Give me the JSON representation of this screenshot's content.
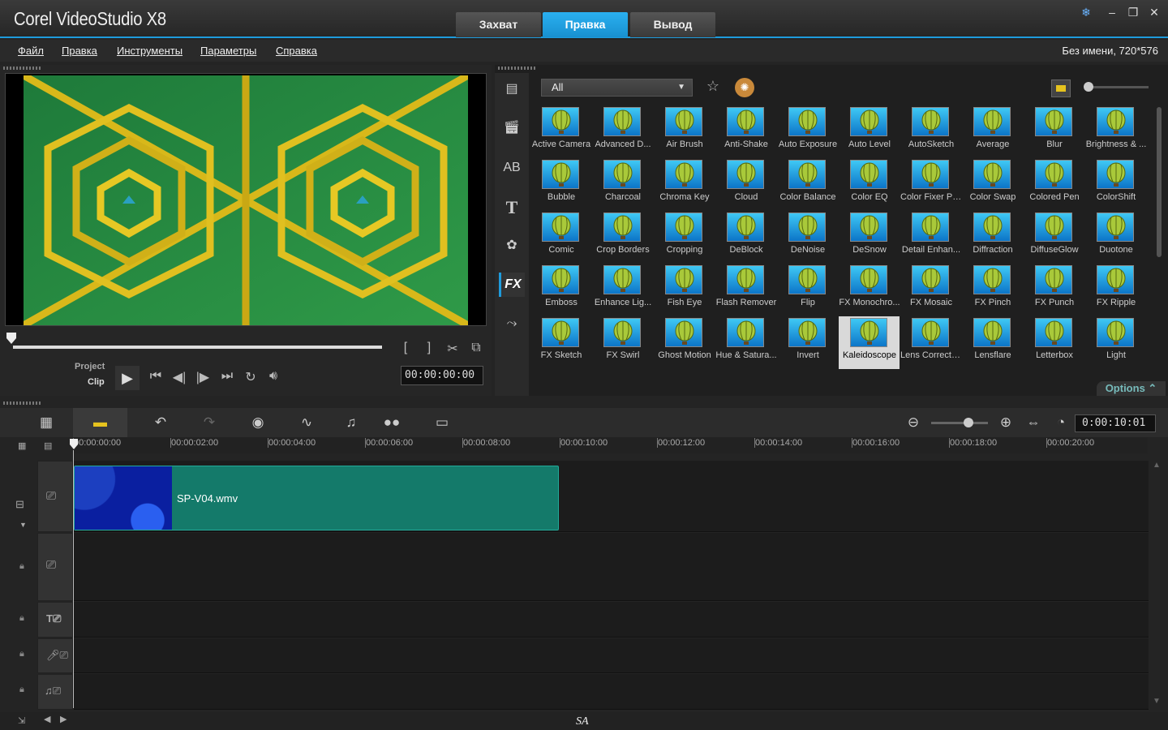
{
  "app": {
    "title": "Corel VideoStudio X8"
  },
  "mode_tabs": [
    {
      "label": "Захват"
    },
    {
      "label": "Правка"
    },
    {
      "label": "Вывод"
    }
  ],
  "window_buttons": {
    "minimize": "–",
    "restore": "❐",
    "close": "✕"
  },
  "menu": [
    "Файл",
    "Правка",
    "Инструменты",
    "Параметры",
    "Справка"
  ],
  "project_info": "Без имени, 720*576",
  "player": {
    "project_label": "Project",
    "clip_label": "Clip",
    "timecode": "00:00:00:00"
  },
  "library": {
    "filter_selected": "All",
    "options_label": "Options",
    "filters": [
      "Active Camera",
      "Advanced D...",
      "Air Brush",
      "Anti-Shake",
      "Auto Exposure",
      "Auto Level",
      "AutoSketch",
      "Average",
      "Blur",
      "Brightness & ...",
      "Bubble",
      "Charcoal",
      "Chroma Key",
      "Cloud",
      "Color Balance",
      "Color EQ",
      "Color Fixer Plus",
      "Color Swap",
      "Colored Pen",
      "ColorShift",
      "Comic",
      "Crop Borders",
      "Cropping",
      "DeBlock",
      "DeNoise",
      "DeSnow",
      "Detail Enhan...",
      "Diffraction",
      "DiffuseGlow",
      "Duotone",
      "Emboss",
      "Enhance Lig...",
      "Fish Eye",
      "Flash Remover",
      "Flip",
      "FX Monochro...",
      "FX Mosaic",
      "FX Pinch",
      "FX Punch",
      "FX Ripple",
      "FX Sketch",
      "FX Swirl",
      "Ghost Motion",
      "Hue & Satura...",
      "Invert",
      "Kaleidoscope",
      "Lens Correction",
      "Lensflare",
      "Letterbox",
      "Light"
    ],
    "selected_filter": "Kaleidoscope"
  },
  "timeline": {
    "duration": "0:00:10:01",
    "ruler_ticks": [
      "00:00:00:00",
      "00:00:02:00",
      "00:00:04:00",
      "00:00:06:00",
      "00:00:08:00",
      "00:00:10:00",
      "00:00:12:00",
      "00:00:14:00",
      "00:00:16:00",
      "00:00:18:00",
      "00:00:20:00"
    ],
    "clip_name": "SP-V04.wmv"
  },
  "status": {
    "text": "SA"
  },
  "colors": {
    "accent": "#1e9bdc",
    "clip": "#147a6a",
    "selected_thumb": "#d9d9d9"
  }
}
